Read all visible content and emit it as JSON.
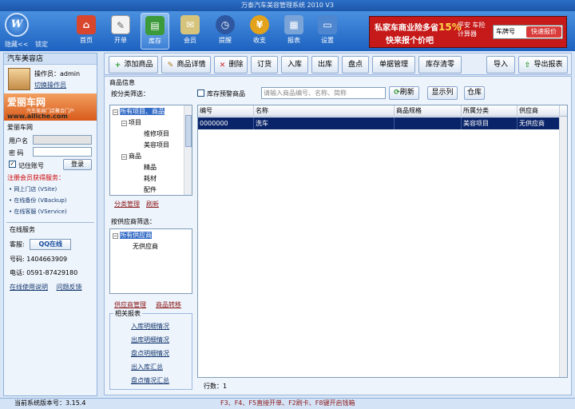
{
  "window": {
    "title": "万泰汽车美容管理系统 2010 V3"
  },
  "sidebar_top": {
    "hide": "隐藏<<",
    "lock": "锁定"
  },
  "nav": [
    {
      "label": "首页",
      "icon": "home-icon",
      "color": "#d7462d"
    },
    {
      "label": "开单",
      "icon": "document-icon",
      "color": "#f3f3f3"
    },
    {
      "label": "库存",
      "icon": "inventory-icon",
      "color": "#3d9a3a"
    },
    {
      "label": "会员",
      "icon": "mail-icon",
      "color": "#d6c47d"
    },
    {
      "label": "提醒",
      "icon": "alarm-icon",
      "color": "#2e57a0"
    },
    {
      "label": "收支",
      "icon": "coin-icon",
      "color": "#e2a21c"
    },
    {
      "label": "报表",
      "icon": "report-icon",
      "color": "#7aa3d8"
    },
    {
      "label": "设置",
      "icon": "monitor-icon",
      "color": "#4e86cf"
    }
  ],
  "ad": {
    "line1_pre": "私家车商业险多省",
    "line1_pct": "15%",
    "line2": "快来报个价吧",
    "brand": "平安 车险计算器",
    "plate_placeholder": "车牌号",
    "quote_btn": "快速报价"
  },
  "left": {
    "shop": "汽车美容店",
    "operator": "操作员：admin",
    "switch_op": "切换操作员",
    "banner_title": "爱丽车网",
    "banner_sub": "汽车美容门店聚合门户",
    "banner_url": "www.ailiche.com",
    "login_head": "爱丽车网",
    "username_label": "用户名",
    "password_label": "密  码",
    "remember": "记住账号",
    "login_btn": "登录",
    "register": "注册会员获得服务：",
    "services": [
      "• 网上门店 (VSite)",
      "• 在线备份 (VBackup)",
      "• 在线客服 (VService)"
    ],
    "online_head": "在线服务",
    "kefu_label": "客服:",
    "qq": "QQ在线",
    "qq_no": "号码: 1404663909",
    "phone": "电话: 0591-87429180",
    "manual": "在线使用说明",
    "feedback": "问题反馈"
  },
  "toolbar": {
    "add": "添加商品",
    "detail": "商品详情",
    "delete": "删除",
    "order": "订货",
    "instock": "入库",
    "outstock": "出库",
    "check": "盘点",
    "docs": "单据管理",
    "clear": "库存清零",
    "import": "导入",
    "export": "导出报表"
  },
  "content": {
    "section": "商品信息",
    "by_category": "按分类筛选：",
    "stock_warn": "库存预警商品",
    "search_placeholder": "请输入商品编号、名称、简称",
    "refresh": "刷新",
    "show_cols": "显示列",
    "warehouse": "仓库",
    "category_tree": {
      "root": "所有项目、商品",
      "item_group": "项目",
      "items": [
        "维修项目",
        "美容项目"
      ],
      "goods_group": "商品",
      "goods": [
        "精品",
        "耗材",
        "配件"
      ]
    },
    "cat_manage": "分类管理",
    "cat_refresh": "刷新",
    "by_supplier": "按供应商筛选：",
    "supplier_root": "所有供应商",
    "supplier_none": "无供应商",
    "supplier_manage": "供应商管理",
    "goods_move": "商品转移",
    "reports_head": "相关报表",
    "reports": [
      "入库明细情况",
      "出库明细情况",
      "盘点明细情况",
      "出入库汇总",
      "盘点情况汇总"
    ],
    "columns": [
      "编号",
      "名称",
      "商品规格",
      "所属分类",
      "供应商"
    ],
    "rows": [
      [
        "0000000",
        "洗车",
        "",
        "美容项目",
        "无供应商"
      ]
    ],
    "row_count_label": "行数：",
    "row_count": "1"
  },
  "status": {
    "version": "当前系统版本号：3.15.4",
    "hint": "F3、F4、F5直接开单、F2刷卡、F8键开启钱箱"
  }
}
